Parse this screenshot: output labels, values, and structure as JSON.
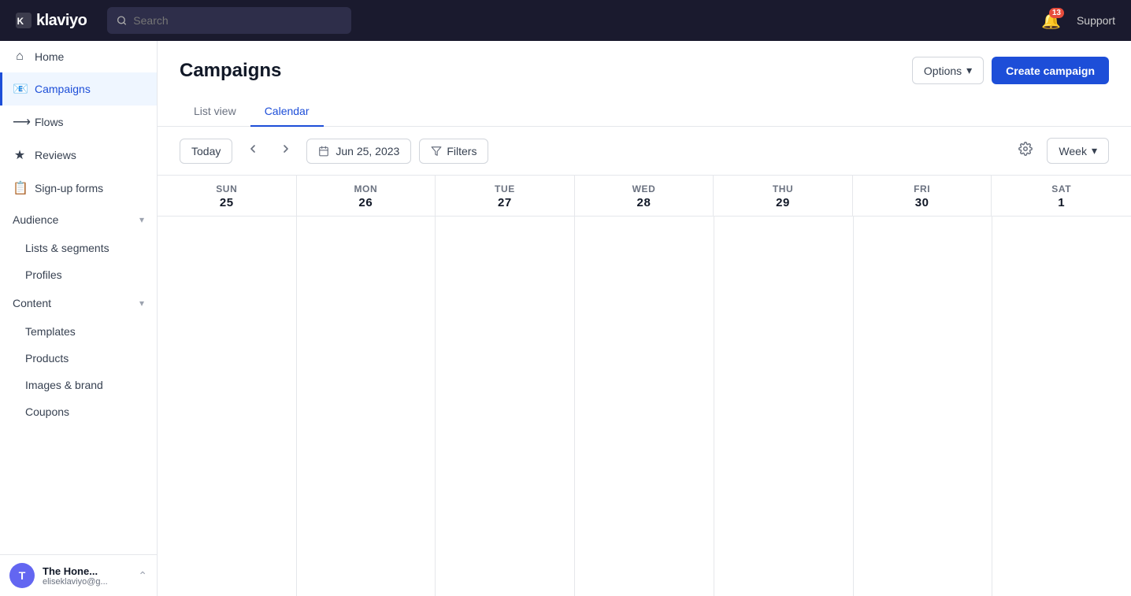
{
  "topnav": {
    "logo": "klaviyo",
    "search_placeholder": "Search",
    "notif_count": "13",
    "support_label": "Support"
  },
  "sidebar": {
    "items": [
      {
        "id": "home",
        "label": "Home",
        "icon": "⌂"
      },
      {
        "id": "campaigns",
        "label": "Campaigns",
        "icon": "📧",
        "active": true
      },
      {
        "id": "flows",
        "label": "Flows",
        "icon": "⟶"
      },
      {
        "id": "reviews",
        "label": "Reviews",
        "icon": "★"
      },
      {
        "id": "sign-up-forms",
        "label": "Sign-up forms",
        "icon": "📋"
      }
    ],
    "audience_section": "Audience",
    "audience_items": [
      {
        "id": "lists-segments",
        "label": "Lists & segments"
      },
      {
        "id": "profiles",
        "label": "Profiles"
      }
    ],
    "content_section": "Content",
    "content_items": [
      {
        "id": "templates",
        "label": "Templates"
      },
      {
        "id": "products",
        "label": "Products"
      },
      {
        "id": "images-brand",
        "label": "Images & brand"
      },
      {
        "id": "coupons",
        "label": "Coupons"
      }
    ],
    "user": {
      "initials": "T",
      "name": "The Hone...",
      "email": "eliseklaviyo@g..."
    }
  },
  "page": {
    "title": "Campaigns",
    "tabs": [
      {
        "id": "list-view",
        "label": "List view"
      },
      {
        "id": "calendar",
        "label": "Calendar",
        "active": true
      }
    ],
    "options_label": "Options",
    "create_label": "Create campaign"
  },
  "toolbar": {
    "today_label": "Today",
    "date_value": "Jun 25, 2023",
    "filters_label": "Filters",
    "week_label": "Week"
  },
  "calendar": {
    "days": [
      {
        "abbr": "SUN",
        "num": "25"
      },
      {
        "abbr": "MON",
        "num": "26"
      },
      {
        "abbr": "TUE",
        "num": "27"
      },
      {
        "abbr": "WED",
        "num": "28"
      },
      {
        "abbr": "THU",
        "num": "29"
      },
      {
        "abbr": "FRI",
        "num": "30"
      },
      {
        "abbr": "SAT",
        "num": "1"
      }
    ]
  }
}
